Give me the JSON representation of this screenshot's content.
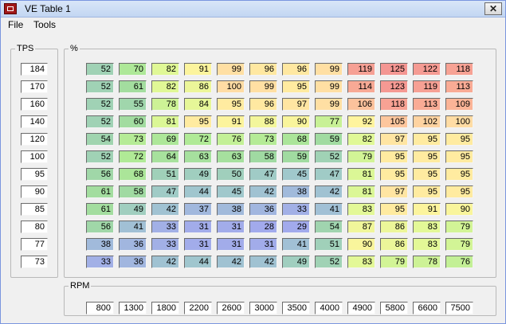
{
  "window": {
    "title": "VE Table 1",
    "close_glyph": "✕"
  },
  "menu": [
    "File",
    "Tools"
  ],
  "tps": {
    "label": "TPS",
    "values": [
      "184",
      "170",
      "160",
      "140",
      "120",
      "100",
      "95",
      "90",
      "85",
      "80",
      "77",
      "73"
    ]
  },
  "ve": {
    "label": "%",
    "rows": [
      [
        "52",
        "70",
        "82",
        "91",
        "99",
        "96",
        "96",
        "99",
        "119",
        "125",
        "122",
        "118"
      ],
      [
        "52",
        "61",
        "82",
        "86",
        "100",
        "99",
        "95",
        "99",
        "114",
        "123",
        "119",
        "113"
      ],
      [
        "52",
        "55",
        "78",
        "84",
        "95",
        "96",
        "97",
        "99",
        "106",
        "118",
        "113",
        "109"
      ],
      [
        "52",
        "60",
        "81",
        "95",
        "91",
        "88",
        "90",
        "77",
        "92",
        "105",
        "102",
        "100"
      ],
      [
        "54",
        "73",
        "69",
        "72",
        "76",
        "73",
        "68",
        "59",
        "82",
        "97",
        "95",
        "95"
      ],
      [
        "52",
        "72",
        "64",
        "63",
        "63",
        "58",
        "59",
        "52",
        "79",
        "95",
        "95",
        "95"
      ],
      [
        "56",
        "68",
        "51",
        "49",
        "50",
        "47",
        "45",
        "47",
        "81",
        "95",
        "95",
        "95"
      ],
      [
        "61",
        "58",
        "47",
        "44",
        "45",
        "42",
        "38",
        "42",
        "81",
        "97",
        "95",
        "95"
      ],
      [
        "61",
        "49",
        "42",
        "37",
        "38",
        "36",
        "33",
        "41",
        "83",
        "95",
        "91",
        "90"
      ],
      [
        "56",
        "41",
        "33",
        "31",
        "31",
        "28",
        "29",
        "54",
        "87",
        "86",
        "83",
        "79"
      ],
      [
        "38",
        "36",
        "33",
        "31",
        "31",
        "31",
        "41",
        "51",
        "90",
        "86",
        "83",
        "79"
      ],
      [
        "33",
        "36",
        "42",
        "44",
        "42",
        "42",
        "49",
        "52",
        "83",
        "79",
        "78",
        "76"
      ]
    ]
  },
  "rpm": {
    "label": "RPM",
    "values": [
      "800",
      "1300",
      "1800",
      "2200",
      "2600",
      "3000",
      "3500",
      "4000",
      "4900",
      "5800",
      "6600",
      "7500"
    ]
  }
}
